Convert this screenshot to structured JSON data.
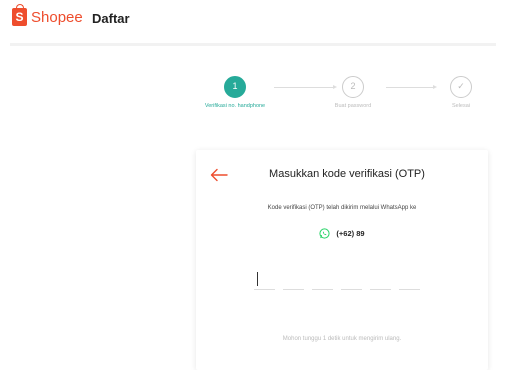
{
  "header": {
    "brand": "Shopee",
    "brand_icon_letter": "S",
    "page_label": "Daftar"
  },
  "stepper": {
    "steps": [
      {
        "number": "1",
        "label": "Verifikasi no. handphone",
        "state": "active"
      },
      {
        "number": "2",
        "label": "Buat password",
        "state": "idle"
      },
      {
        "number": "✓",
        "label": "Selesai",
        "state": "idle"
      }
    ]
  },
  "card": {
    "title": "Masukkan kode verifikasi (OTP)",
    "description": "Kode verifikasi (OTP) telah dikirim melalui WhatsApp ke",
    "phone": "(+62) 89",
    "otp_boxes": [
      "",
      "",
      "",
      "",
      "",
      ""
    ],
    "resend_text": "Mohon tunggu 1 detik untuk mengirim ulang."
  },
  "colors": {
    "brand": "#ee4d2d",
    "step_active": "#26aa99",
    "whatsapp": "#25d366"
  },
  "icons": {
    "back": "arrow-left-icon",
    "channel": "whatsapp-icon"
  }
}
